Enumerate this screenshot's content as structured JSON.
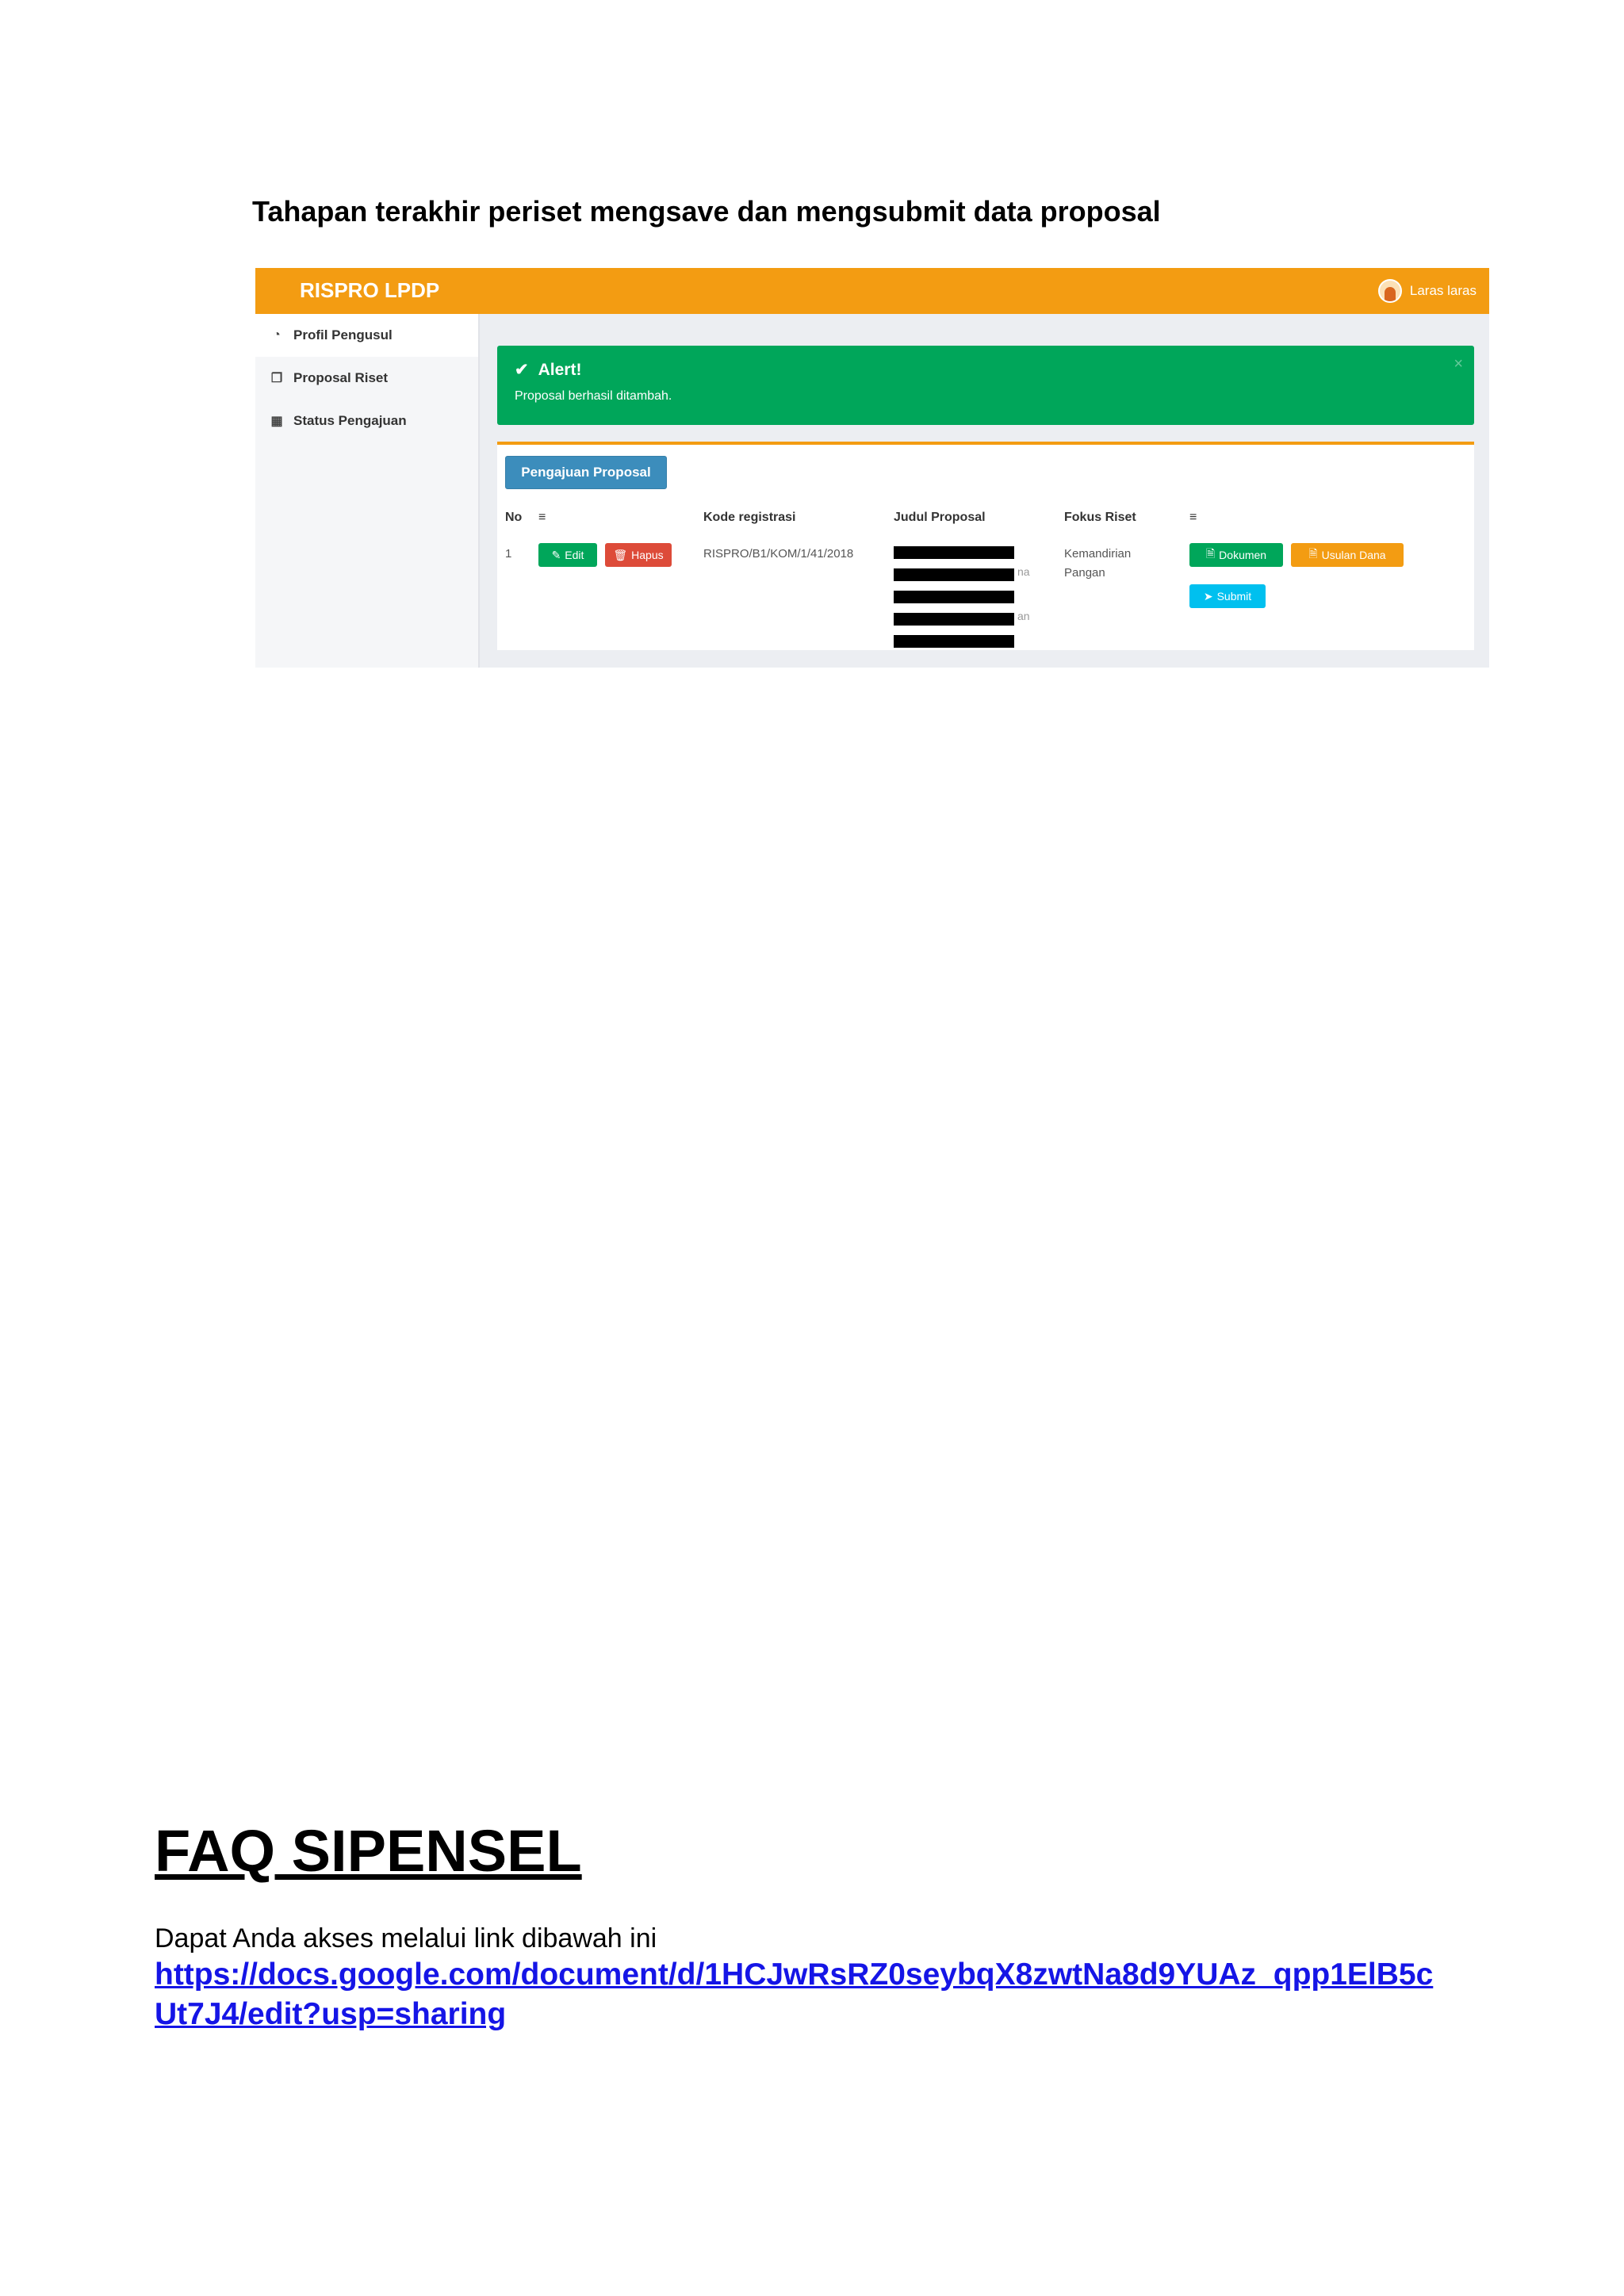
{
  "heading": "Tahapan terakhir periset mengsave dan mengsubmit data proposal",
  "app": {
    "brand": "RISPRO LPDP",
    "user_name": "Laras laras",
    "accent": "#f39c12"
  },
  "sidebar": {
    "items": [
      {
        "label": "Profil Pengusul",
        "icon": "dashboard-icon"
      },
      {
        "label": "Proposal Riset",
        "icon": "copy-icon"
      },
      {
        "label": "Status Pengajuan",
        "icon": "grid-icon"
      }
    ]
  },
  "alert": {
    "title": "Alert!",
    "message": "Proposal berhasil ditambah.",
    "close": "×",
    "color": "#00a65a"
  },
  "main": {
    "add_button": "Pengajuan Proposal",
    "columns": [
      "No",
      "≡",
      "Kode registrasi",
      "Judul Proposal",
      "Fokus Riset",
      "≡"
    ],
    "row": {
      "no": "1",
      "edit_label": "Edit",
      "delete_label": "Hapus",
      "kode": "RISPRO/B1/KOM/1/41/2018",
      "fokus_line1": "Kemandirian",
      "fokus_line2": "Pangan",
      "dokumen_label": "Dokumen",
      "usulan_label": "Usulan Dana",
      "submit_label": "Submit"
    }
  },
  "faq": {
    "title": "FAQ SIPENSEL",
    "intro": "Dapat Anda akses melalui link dibawah ini",
    "link": "https://docs.google.com/document/d/1HCJwRsRZ0seybqX8zwtNa8d9YUAz_qpp1ElB5cUt7J4/edit?usp=sharing"
  }
}
